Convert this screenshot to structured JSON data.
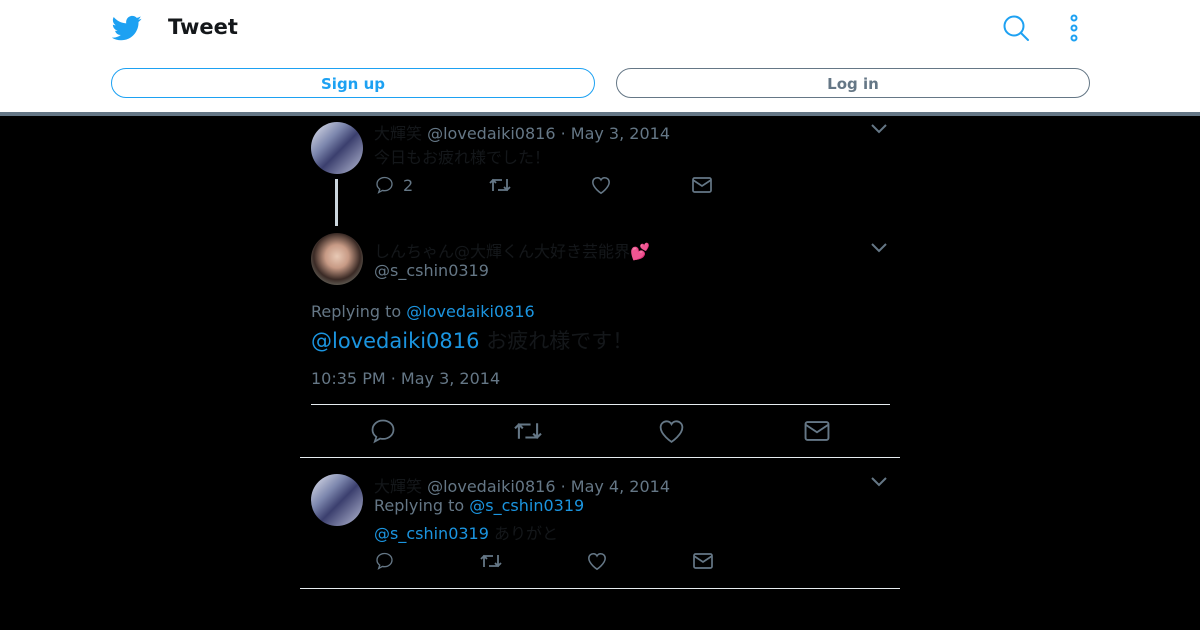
{
  "header": {
    "title": "Tweet",
    "signup_label": "Sign up",
    "login_label": "Log in"
  },
  "tweets": [
    {
      "display_name": "大輝笑",
      "handle": "@lovedaiki0816",
      "date": "May 3, 2014",
      "text": "今日もお疲れ様でした！",
      "reply_count": "2"
    },
    {
      "display_name": "しんちゃん@大輝くん大好き芸能界",
      "emoji": "💕",
      "handle": "@s_cshin0319",
      "replying_prefix": "Replying to",
      "replying_handle": "@lovedaiki0816",
      "text_mention": "@lovedaiki0816",
      "text": "お疲れ様です！",
      "timestamp": "10:35 PM · May 3, 2014"
    },
    {
      "display_name": "大輝笑",
      "handle": "@lovedaiki0816",
      "date": "May 4, 2014",
      "replying_prefix": "Replying to",
      "replying_handle": "@s_cshin0319",
      "text_mention": "@s_cshin0319",
      "text": "ありがと"
    }
  ],
  "colors": {
    "accent": "#1da1f2",
    "muted": "#657786",
    "link": "#1b95e0"
  }
}
